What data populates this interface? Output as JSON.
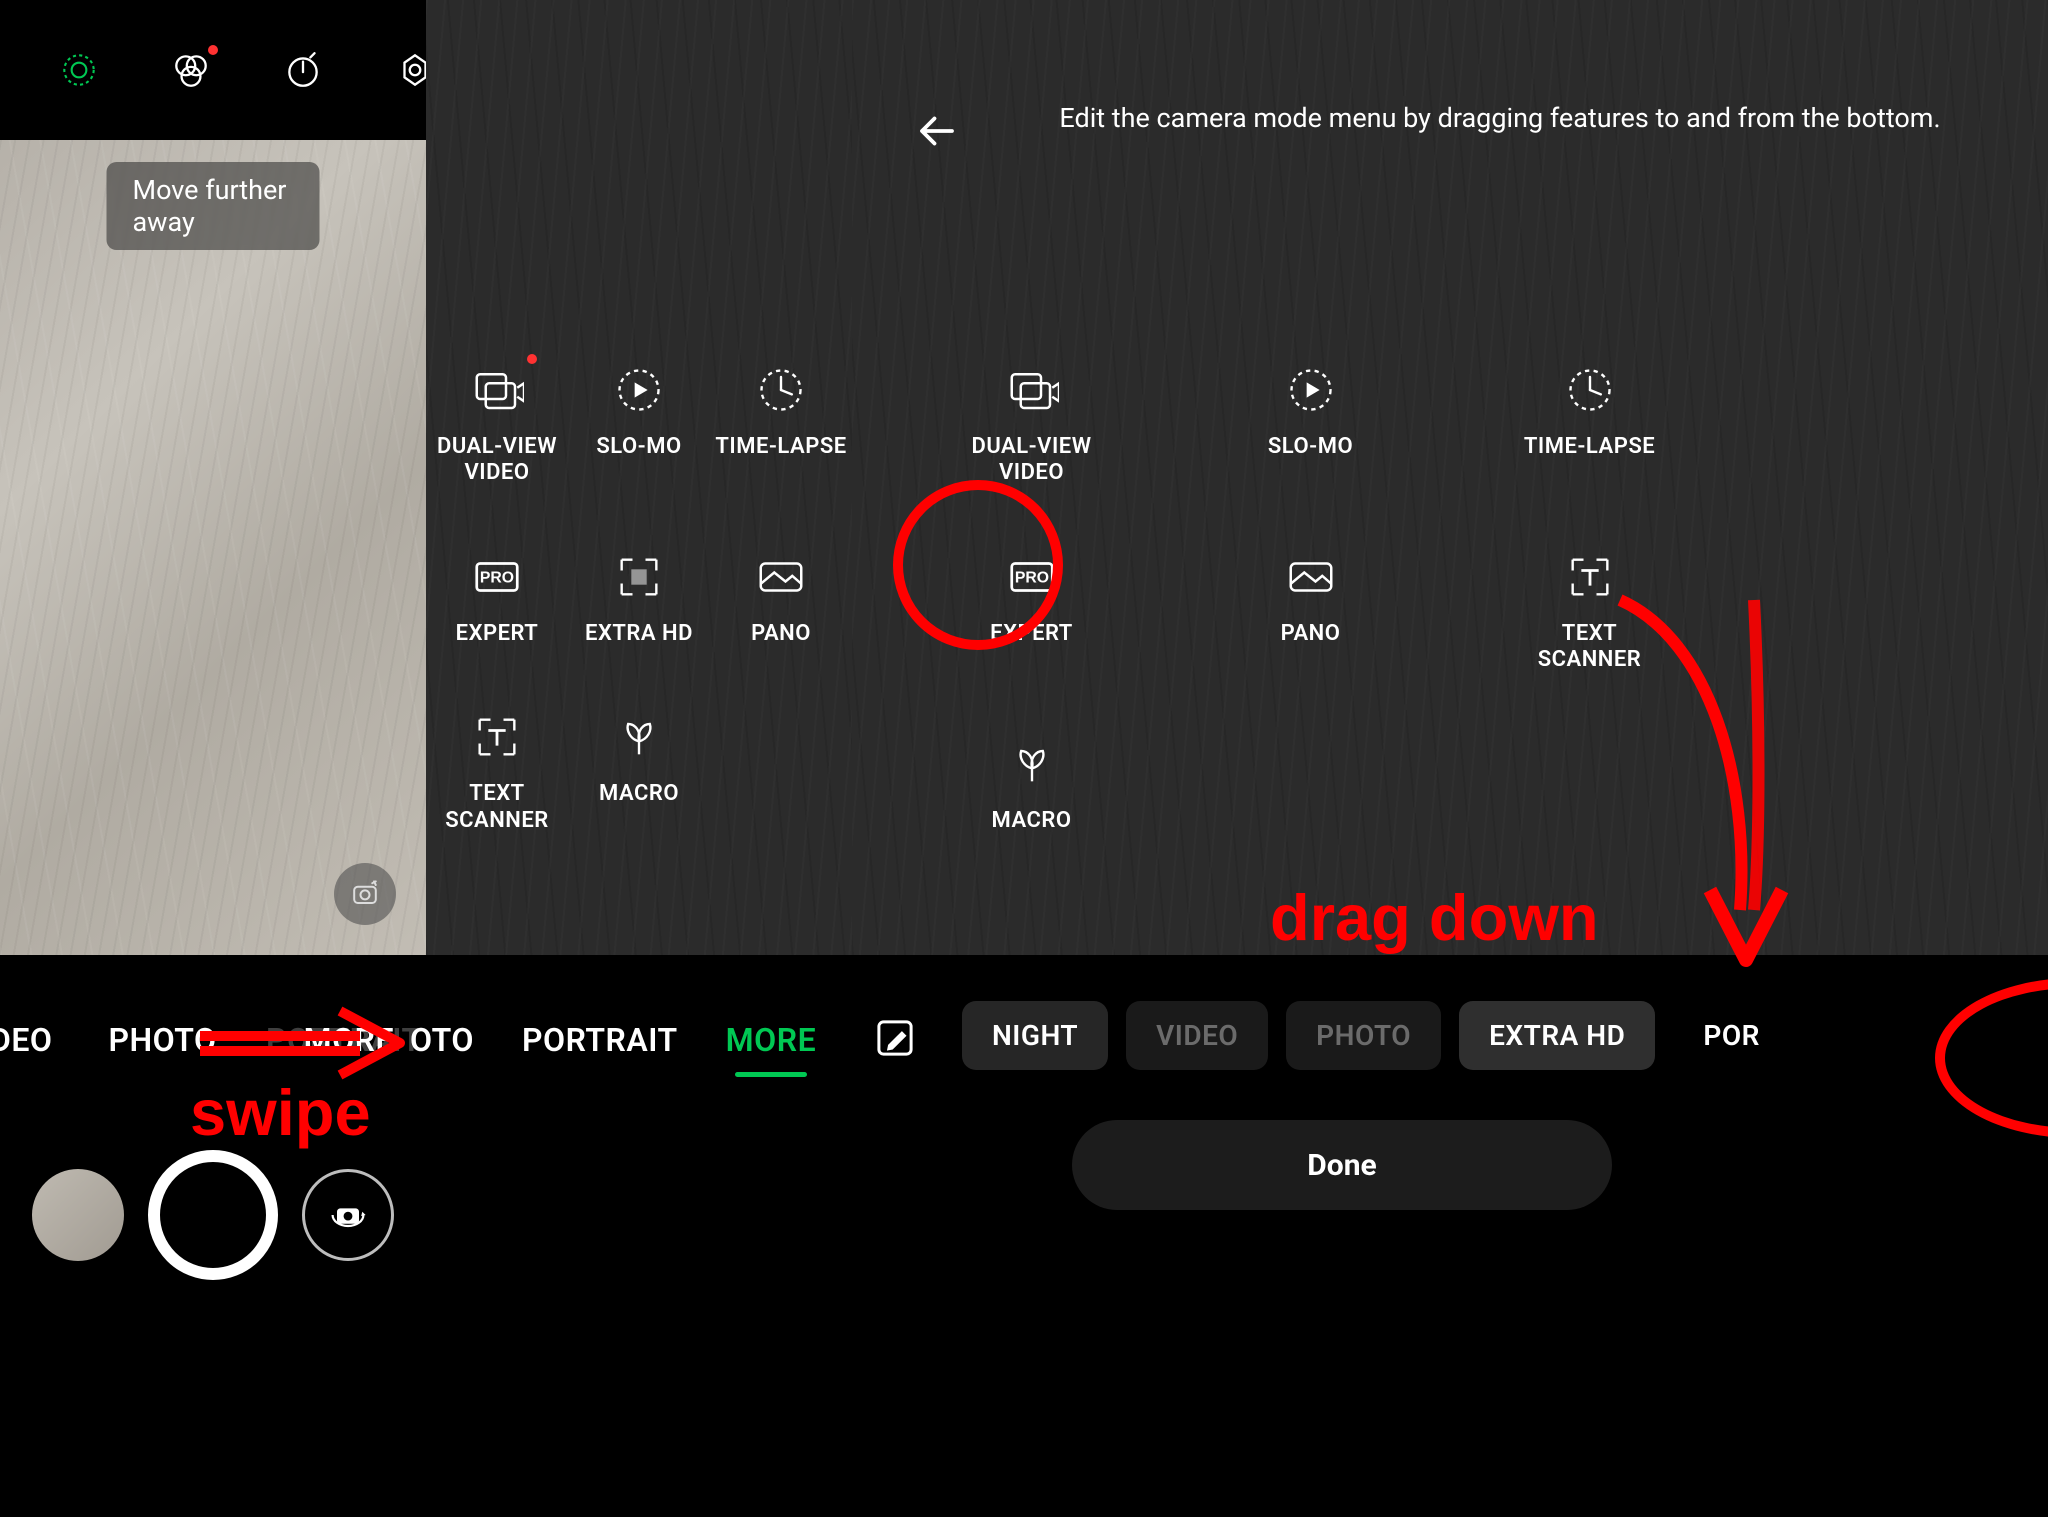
{
  "toast": "Move further away",
  "left_modes": {
    "video_cut": "DEO",
    "photo": "PHOTO",
    "portrait": "PORTRAIT",
    "more": "MORE"
  },
  "mid_modes": {
    "photo_cut": "OTO",
    "portrait": "PORTRAIT",
    "more": "MORE"
  },
  "edit_header": "Edit the camera mode menu by dragging features to and from the bottom.",
  "mid_grid": {
    "dualview": "DUAL-VIEW VIDEO",
    "slomo": "SLO-MO",
    "timelapse": "TIME-LAPSE",
    "expert": "EXPERT",
    "extrahd": "EXTRA HD",
    "pano": "PANO",
    "textscan": "TEXT SCANNER",
    "macro": "MACRO"
  },
  "right_grid": {
    "dualview": "DUAL-VIEW VIDEO",
    "slomo": "SLO-MO",
    "timelapse": "TIME-LAPSE",
    "expert": "EXPERT",
    "pano": "PANO",
    "textscan": "TEXT SCANNER",
    "macro": "MACRO"
  },
  "chips": {
    "night": "NIGHT",
    "video": "VIDEO",
    "photo": "PHOTO",
    "extrahd": "EXTRA HD",
    "portrait_cut": "POR"
  },
  "done": "Done",
  "anno": {
    "swipe": "swipe",
    "dragdown": "drag down"
  }
}
